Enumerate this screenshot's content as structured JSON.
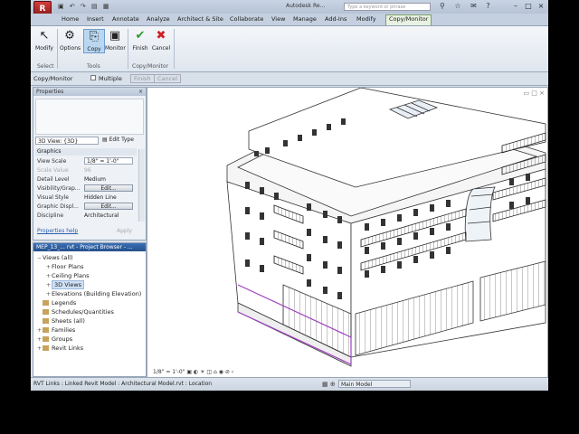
{
  "window": {
    "app_button": "R",
    "title": "Autodesk Re...",
    "search_placeholder": "Type a keyword or phrase",
    "quick_access": "▣ ↶ ↷ ▤ ▦",
    "toolbar_icons": "⚲ ☆ ✉ ?",
    "controls": {
      "minimize": "–",
      "maximize": "□",
      "close": "×"
    }
  },
  "tabs": [
    "Home",
    "Insert",
    "Annotate",
    "Analyze",
    "Architect & Site",
    "Collaborate",
    "View",
    "Manage",
    "Add-Ins",
    "Modify",
    "Copy/Monitor"
  ],
  "active_tab": "Copy/Monitor",
  "ribbon": {
    "buttons": [
      {
        "label": "Modify",
        "icon": "↖"
      },
      {
        "label": "Options",
        "icon": "⚙"
      },
      {
        "label": "Copy",
        "icon": "⎘"
      },
      {
        "label": "Monitor",
        "icon": "▣"
      },
      {
        "label": "Finish",
        "icon": "✔"
      },
      {
        "label": "Cancel",
        "icon": "✖"
      }
    ],
    "panels": [
      "Select",
      "Tools",
      "Copy/Monitor"
    ]
  },
  "options_bar": {
    "context": "Copy/Monitor",
    "multiple_label": "Multiple",
    "finish": "Finish",
    "cancel": "Cancel"
  },
  "properties": {
    "title": "Properties",
    "type_selector": "3D View: {3D}",
    "edit_type": "Edit Type",
    "section": "Graphics",
    "rows": [
      {
        "key": "View Scale",
        "value": "1/8\" = 1'-0\"",
        "style": "box"
      },
      {
        "key": "Scale Value",
        "value": "96",
        "style": "dim"
      },
      {
        "key": "Detail Level",
        "value": "Medium",
        "style": "text"
      },
      {
        "key": "Visibility/Grap...",
        "value": "Edit...",
        "style": "btn"
      },
      {
        "key": "Visual Style",
        "value": "Hidden Line",
        "style": "text"
      },
      {
        "key": "Graphic Displ...",
        "value": "Edit...",
        "style": "btn"
      },
      {
        "key": "Discipline",
        "value": "Architectural",
        "style": "text"
      }
    ],
    "help_link": "Properties help",
    "apply": "Apply"
  },
  "browser": {
    "title": "MEP_13_... rvt - Project Browser - ...",
    "items": [
      {
        "label": "Views (all)",
        "depth": 0,
        "toggle": "−",
        "folder": false
      },
      {
        "label": "Floor Plans",
        "depth": 1,
        "toggle": "+",
        "folder": false
      },
      {
        "label": "Ceiling Plans",
        "depth": 1,
        "toggle": "+",
        "folder": false
      },
      {
        "label": "3D Views",
        "depth": 1,
        "toggle": "+",
        "folder": false,
        "selected": true
      },
      {
        "label": "Elevations (Building Elevation)",
        "depth": 1,
        "toggle": "+",
        "folder": false
      },
      {
        "label": "Legends",
        "depth": 0,
        "toggle": "",
        "folder": true
      },
      {
        "label": "Schedules/Quantities",
        "depth": 0,
        "toggle": "",
        "folder": true
      },
      {
        "label": "Sheets (all)",
        "depth": 0,
        "toggle": "",
        "folder": true
      },
      {
        "label": "Families",
        "depth": 0,
        "toggle": "+",
        "folder": true
      },
      {
        "label": "Groups",
        "depth": 0,
        "toggle": "+",
        "folder": true
      },
      {
        "label": "Revit Links",
        "depth": 0,
        "toggle": "+",
        "folder": true
      }
    ]
  },
  "view": {
    "scale": "1/8\" = 1'-0\"",
    "control_icons": "▣ ◐ ☀ ◫ ⌂ ◉ ⊘ ‹"
  },
  "status": {
    "text": "RVT Links : Linked Revit Model : Architectural Model.rvt : Location",
    "model": "Main Model",
    "icons": "▦ ⊕"
  }
}
